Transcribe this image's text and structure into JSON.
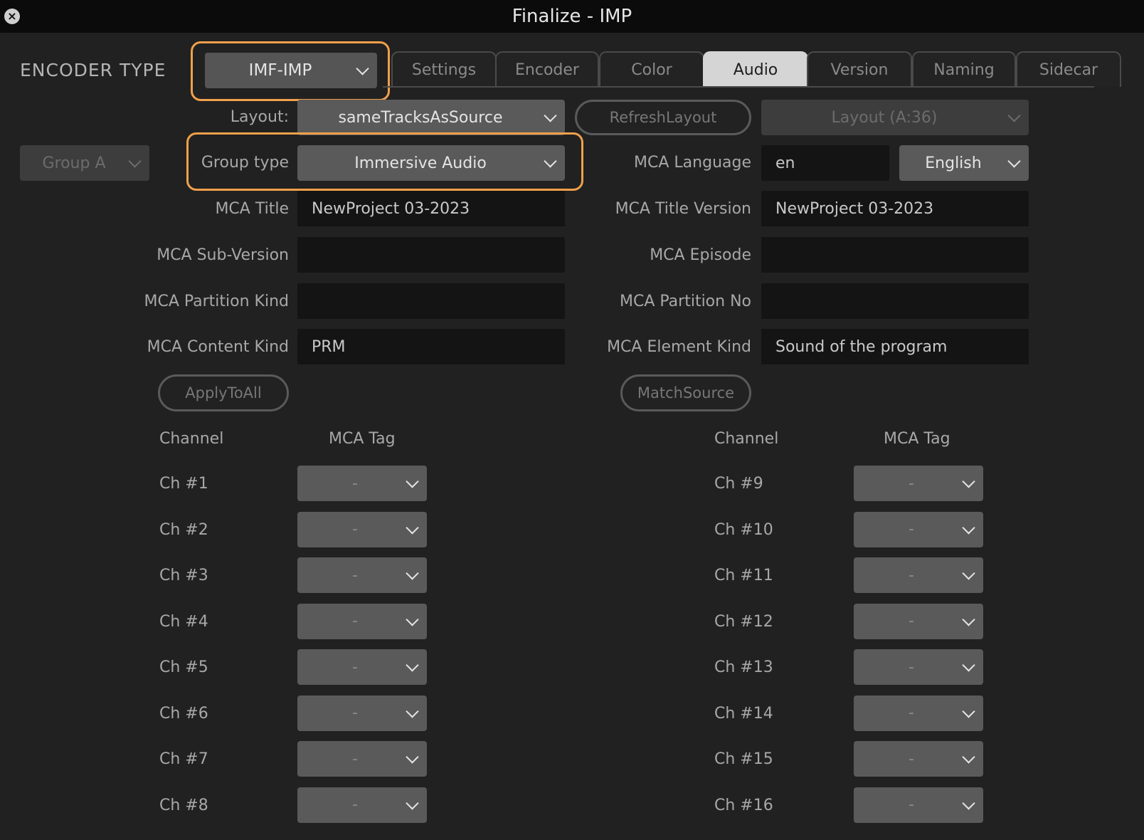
{
  "window": {
    "title": "Finalize - IMP"
  },
  "encoder": {
    "label": "ENCODER TYPE",
    "value": "IMF-IMP"
  },
  "tabs": [
    {
      "label": "Settings",
      "active": false
    },
    {
      "label": "Encoder",
      "active": false
    },
    {
      "label": "Color",
      "active": false
    },
    {
      "label": "Audio",
      "active": true
    },
    {
      "label": "Version",
      "active": false
    },
    {
      "label": "Naming",
      "active": false
    },
    {
      "label": "Sidecar",
      "active": false
    }
  ],
  "layout": {
    "label": "Layout:",
    "value": "sameTracksAsSource",
    "refresh_label": "RefreshLayout",
    "secondary_value": "Layout (A:36)"
  },
  "group": {
    "value": "Group A",
    "type_label": "Group type",
    "type_value": "Immersive Audio"
  },
  "mca_language": {
    "label": "MCA Language",
    "code": "en",
    "language": "English"
  },
  "fields": {
    "mca_title": {
      "label": "MCA Title",
      "value": "NewProject 03-2023"
    },
    "mca_title_version": {
      "label": "MCA Title Version",
      "value": "NewProject 03-2023"
    },
    "mca_sub_version": {
      "label": "MCA Sub-Version",
      "value": ""
    },
    "mca_episode": {
      "label": "MCA Episode",
      "value": ""
    },
    "mca_partition_kind": {
      "label": "MCA Partition Kind",
      "value": ""
    },
    "mca_partition_no": {
      "label": "MCA Partition No",
      "value": ""
    },
    "mca_content_kind": {
      "label": "MCA Content Kind",
      "value": "PRM"
    },
    "mca_element_kind": {
      "label": "MCA Element Kind",
      "value": "Sound of the program"
    }
  },
  "buttons": {
    "apply_to_all": "ApplyToAll",
    "match_source": "MatchSource"
  },
  "channels": {
    "channel_header": "Channel",
    "tag_header": "MCA Tag",
    "left": [
      {
        "name": "Ch #1",
        "tag": "-"
      },
      {
        "name": "Ch #2",
        "tag": "-"
      },
      {
        "name": "Ch #3",
        "tag": "-"
      },
      {
        "name": "Ch #4",
        "tag": "-"
      },
      {
        "name": "Ch #5",
        "tag": "-"
      },
      {
        "name": "Ch #6",
        "tag": "-"
      },
      {
        "name": "Ch #7",
        "tag": "-"
      },
      {
        "name": "Ch #8",
        "tag": "-"
      }
    ],
    "right": [
      {
        "name": "Ch #9",
        "tag": "-"
      },
      {
        "name": "Ch #10",
        "tag": "-"
      },
      {
        "name": "Ch #11",
        "tag": "-"
      },
      {
        "name": "Ch #12",
        "tag": "-"
      },
      {
        "name": "Ch #13",
        "tag": "-"
      },
      {
        "name": "Ch #14",
        "tag": "-"
      },
      {
        "name": "Ch #15",
        "tag": "-"
      },
      {
        "name": "Ch #16",
        "tag": "-"
      }
    ]
  },
  "colors": {
    "highlight": "#f0a04b",
    "active_tab": "#d5d5d5",
    "background": "#212121"
  }
}
